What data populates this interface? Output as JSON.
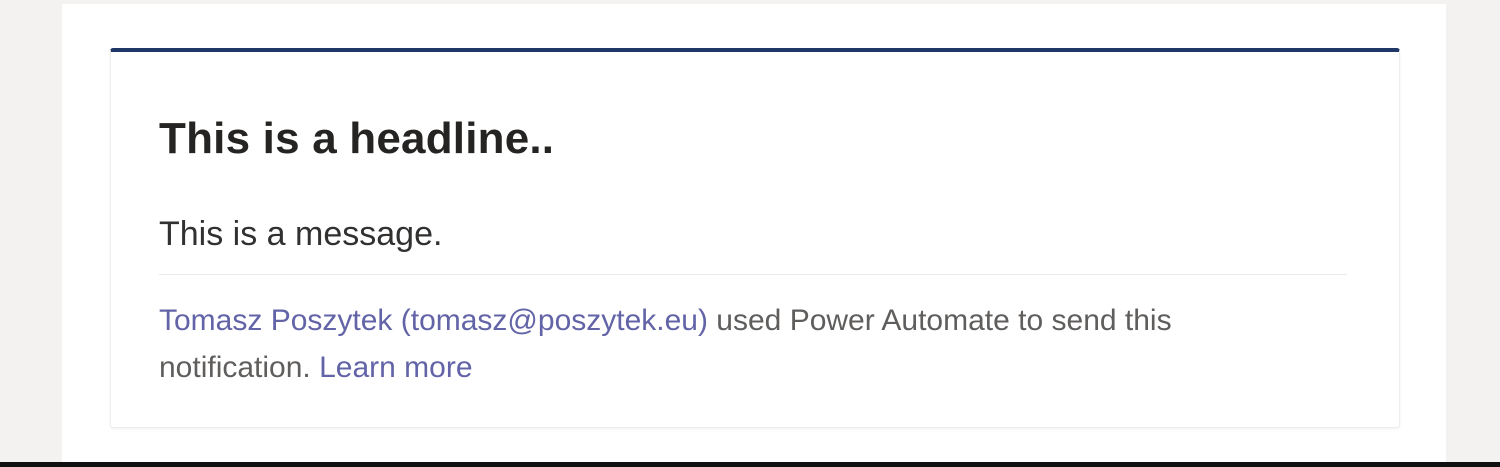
{
  "card": {
    "accent_color": "#1f3766",
    "headline": "This is a headline..",
    "message": "This is a message.",
    "footer": {
      "sender_link": "Tomasz Poszytek (tomasz@poszytek.eu)",
      "text": " used Power Automate to send this notification. ",
      "learn_more_link": "Learn more",
      "link_color": "#6264a7"
    }
  }
}
